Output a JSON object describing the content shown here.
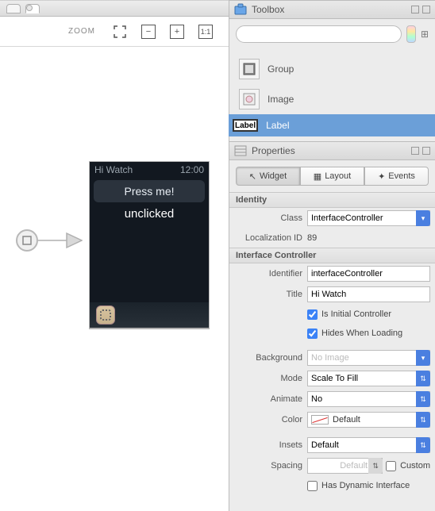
{
  "toolbar": {
    "zoom_label": "ZOOM"
  },
  "watch": {
    "title": "Hi Watch",
    "time": "12:00",
    "button": "Press me!",
    "label": "unclicked"
  },
  "toolbox": {
    "title": "Toolbox",
    "search_placeholder": "",
    "items": [
      {
        "label": "Group"
      },
      {
        "label": "Image"
      },
      {
        "label": "Label"
      }
    ],
    "chip": "Label"
  },
  "properties": {
    "title": "Properties",
    "tabs": {
      "widget": "Widget",
      "layout": "Layout",
      "events": "Events"
    },
    "sections": {
      "identity": "Identity",
      "ic": "Interface Controller"
    },
    "labels": {
      "class": "Class",
      "locid": "Localization ID",
      "identifier": "Identifier",
      "title": "Title",
      "is_initial": "Is Initial Controller",
      "hides": "Hides When Loading",
      "background": "Background",
      "mode": "Mode",
      "animate": "Animate",
      "color": "Color",
      "insets": "Insets",
      "spacing": "Spacing",
      "custom": "Custom",
      "dynamic": "Has Dynamic Interface"
    },
    "values": {
      "class": "InterfaceController",
      "locid": "89",
      "identifier": "interfaceController",
      "title": "Hi Watch",
      "background": "No Image",
      "mode": "Scale To Fill",
      "animate": "No",
      "color": "Default",
      "insets": "Default",
      "spacing": "Default"
    }
  }
}
